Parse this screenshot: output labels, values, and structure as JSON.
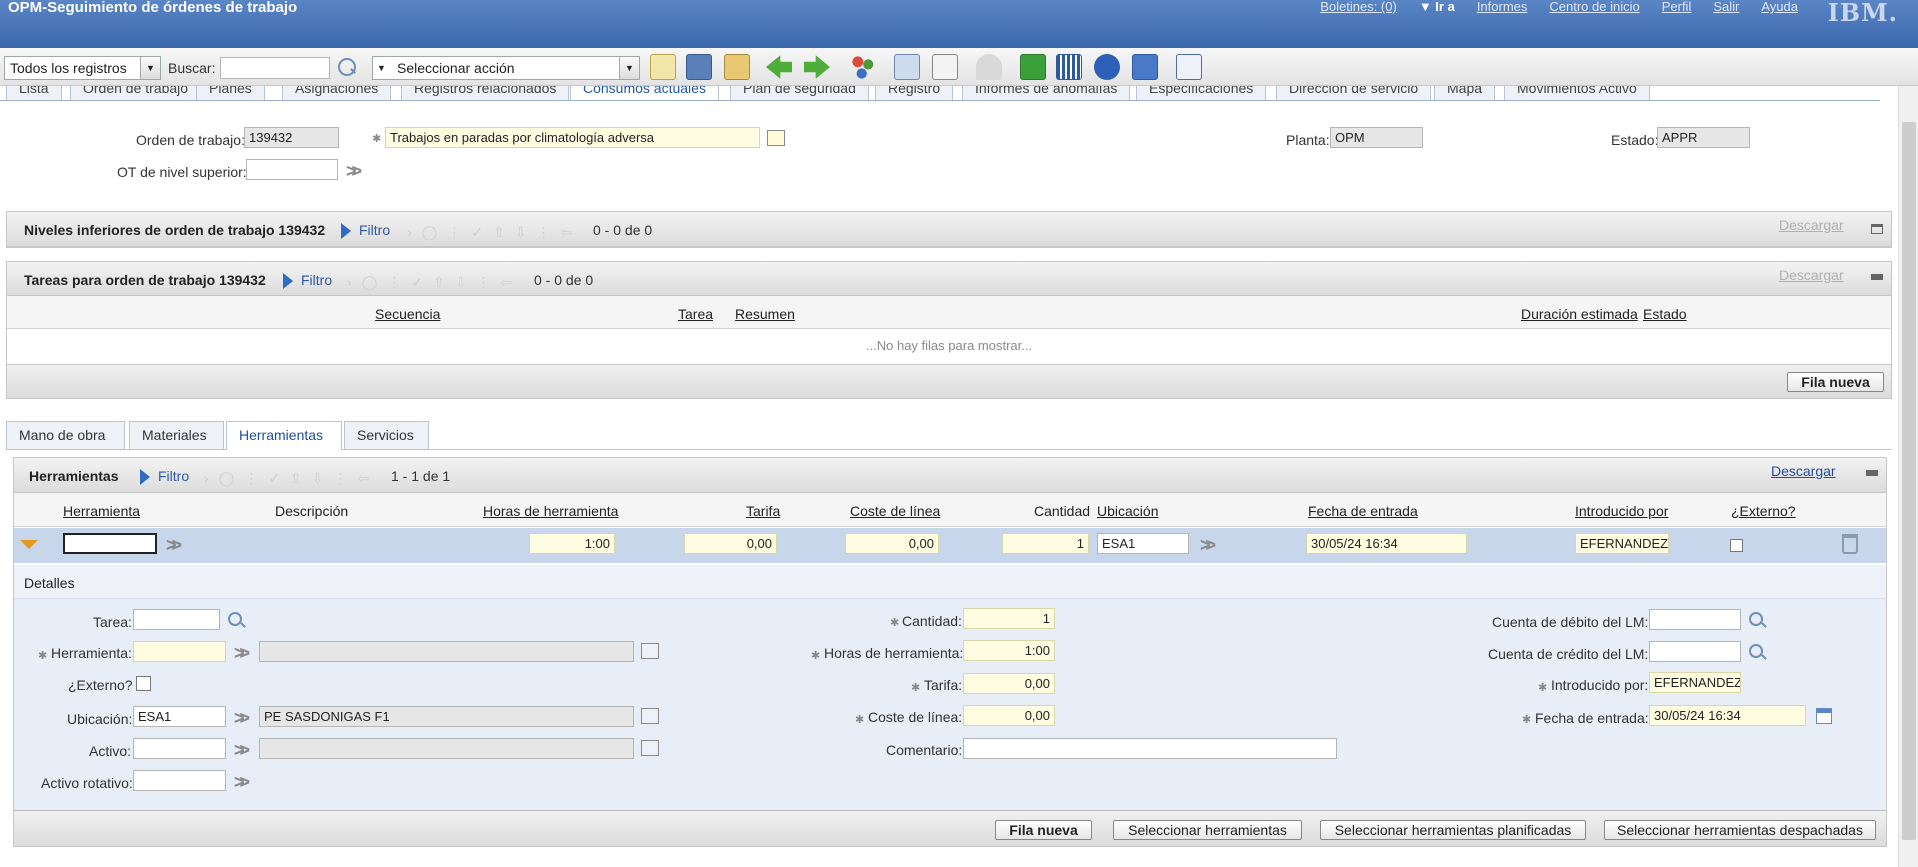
{
  "app": {
    "title": "OPM-Seguimiento de órdenes de trabajo",
    "links": [
      "Boletines: (0)",
      "Ir a",
      "Informes",
      "Centro de inicio",
      "Perfil",
      "Salir",
      "Ayuda"
    ],
    "brand": "IBM."
  },
  "toolbar": {
    "records": "Todos los registros",
    "search_label": "Buscar:",
    "search_value": "",
    "action": "Seleccionar acción"
  },
  "tabs": [
    "Lista",
    "Orden de trabajo",
    "Planes",
    "Asignaciones",
    "Registros relacionados",
    "Consumos actuales",
    "Plan de seguridad",
    "Registro",
    "Informes de anomalías",
    "Especificaciones",
    "Dirección de servicio",
    "Mapa",
    "Movimientos Activo"
  ],
  "header": {
    "ot_label": "Orden de trabajo:",
    "ot_value": "139432",
    "desc": "Trabajos en paradas por climatología adversa",
    "parent_label": "OT de nivel superior:",
    "parent_value": "",
    "planta_label": "Planta:",
    "planta_value": "OPM",
    "estado_label": "Estado:",
    "estado_value": "APPR"
  },
  "niveles": {
    "title": "Niveles inferiores de orden de trabajo 139432",
    "filtro": "Filtro",
    "pager": "0 - 0 de 0",
    "descargar": "Descargar"
  },
  "tareas": {
    "title": "Tareas para orden de trabajo 139432",
    "filtro": "Filtro",
    "pager": "0 - 0 de 0",
    "descargar": "Descargar",
    "cols": [
      "Secuencia",
      "Tarea",
      "Resumen",
      "Duración estimada",
      "Estado"
    ],
    "empty": "...No hay filas para mostrar...",
    "new_row": "Fila nueva"
  },
  "subtabs": [
    "Mano de obra",
    "Materiales",
    "Herramientas",
    "Servicios"
  ],
  "herr": {
    "title": "Herramientas",
    "filtro": "Filtro",
    "pager": "1 - 1 de 1",
    "descargar": "Descargar",
    "cols": [
      "Herramienta",
      "Descripción",
      "Horas de herramienta",
      "Tarifa",
      "Coste de línea",
      "Cantidad",
      "Ubicación",
      "Fecha de entrada",
      "Introducido por",
      "¿Externo?"
    ],
    "row": {
      "herramienta": "",
      "descripcion": "",
      "horas": "1:00",
      "tarifa": "0,00",
      "coste": "0,00",
      "cantidad": "1",
      "ubicacion": "ESA1",
      "fecha": "30/05/24 16:34",
      "introducido": "EFERNANDEZ",
      "externo": false
    }
  },
  "detalles": {
    "title": "Detalles",
    "tarea_l": "Tarea:",
    "tarea": "",
    "herramienta_l": "Herramienta:",
    "herramienta": "",
    "externo_l": "¿Externo?",
    "ubicacion_l": "Ubicación:",
    "ubicacion": "ESA1",
    "ubicacion_desc": "PE SASDONIGAS F1",
    "activo_l": "Activo:",
    "activo": "",
    "rotativo_l": "Activo rotativo:",
    "rotativo": "",
    "cantidad_l": "Cantidad:",
    "cantidad": "1",
    "horas_l": "Horas de herramienta:",
    "horas": "1:00",
    "tarifa_l": "Tarifa:",
    "tarifa": "0,00",
    "coste_l": "Coste de línea:",
    "coste": "0,00",
    "comentario_l": "Comentario:",
    "comentario": "",
    "debito_l": "Cuenta de débito del LM:",
    "debito": "",
    "credito_l": "Cuenta de crédito del LM:",
    "credito": "",
    "intro_l": "Introducido por:",
    "intro": "EFERNANDEZ",
    "fecha_l": "Fecha de entrada:",
    "fecha": "30/05/24 16:34"
  },
  "footer": {
    "b1": "Fila nueva",
    "b2": "Seleccionar herramientas",
    "b3": "Seleccionar herramientas planificadas",
    "b4": "Seleccionar herramientas despachadas"
  }
}
